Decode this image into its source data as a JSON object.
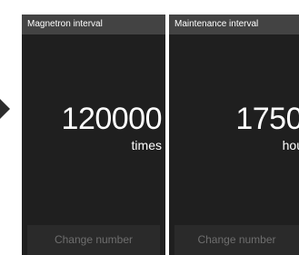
{
  "panels": [
    {
      "title": "Magnetron interval",
      "value": "120000",
      "unit": "times",
      "button": "Change number"
    },
    {
      "title": "Maintenance interval",
      "value": "1750",
      "unit": "hou",
      "button": "Change number"
    }
  ],
  "colors": {
    "panel_bg": "#1f1f1f",
    "header_bg": "#434343",
    "button_bg": "#2a2a2a",
    "button_text": "#6e6e6e",
    "text": "#ffffff",
    "arrow": "#2c2c2c"
  },
  "icons": {
    "left_arrow": "chevron-left-icon"
  }
}
